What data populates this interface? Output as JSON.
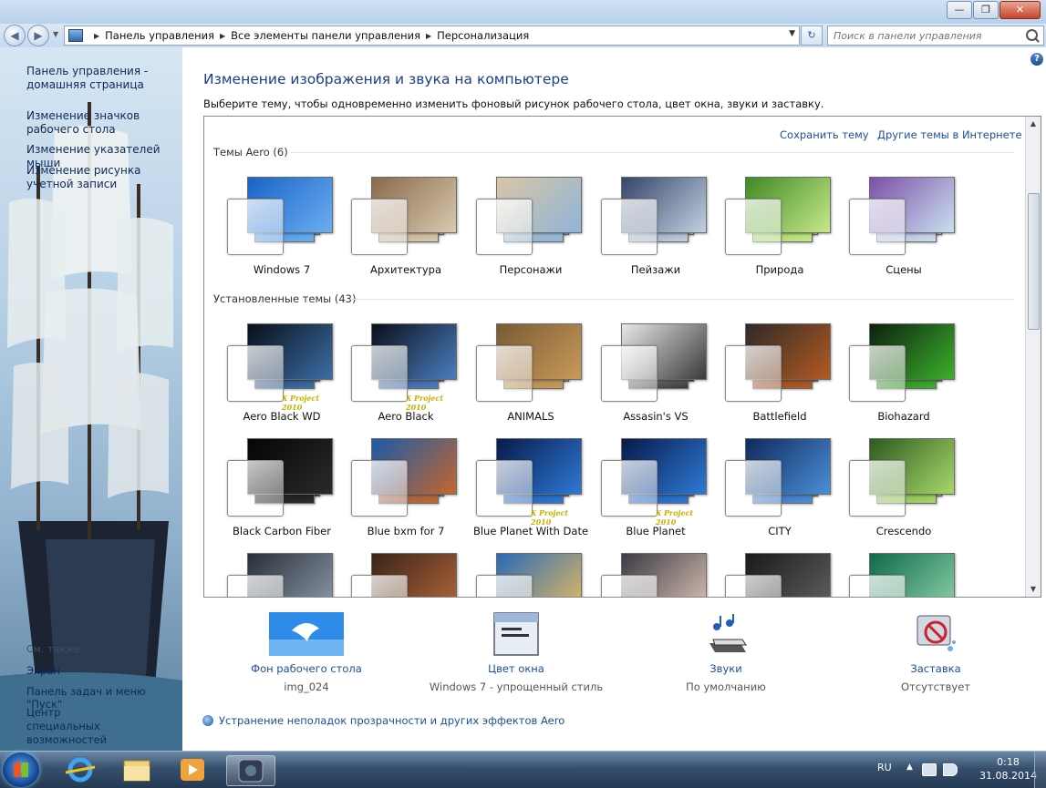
{
  "window": {
    "minimize": "—",
    "maximize": "❐",
    "close": "✕"
  },
  "address": {
    "crumbs": [
      "Панель управления",
      "Все элементы панели управления",
      "Персонализация"
    ],
    "search_placeholder": "Поиск в панели управления"
  },
  "sidebar": {
    "links": [
      {
        "label": "Панель управления - домашняя страница"
      },
      {
        "label": "Изменение значков рабочего стола"
      },
      {
        "label": "Изменение указателей мыши"
      },
      {
        "label": "Изменение рисунка учетной записи"
      }
    ],
    "see_also_title": "См. также",
    "see_also": [
      "Экран",
      "Панель задач и меню \"Пуск\"",
      "Центр специальных возможностей"
    ]
  },
  "main": {
    "title": "Изменение изображения и звука на компьютере",
    "subtitle": "Выберите тему, чтобы одновременно изменить фоновый рисунок рабочего стола, цвет окна, звуки и заставку.",
    "save_theme": "Сохранить тему",
    "other_themes": "Другие темы в Интернете",
    "aero_label": "Темы Aero (6)",
    "installed_label": "Установленные темы (43)",
    "watermark": "X Project 2010",
    "aero_themes": [
      {
        "name": "Windows 7",
        "colors": [
          "#1a63c7",
          "#6aaef0"
        ]
      },
      {
        "name": "Архитектура",
        "colors": [
          "#8a6a4a",
          "#d8c9b0"
        ]
      },
      {
        "name": "Персонажи",
        "colors": [
          "#d9c6a5",
          "#8fb5d8"
        ]
      },
      {
        "name": "Пейзажи",
        "colors": [
          "#35456a",
          "#c2d0e0"
        ]
      },
      {
        "name": "Природа",
        "colors": [
          "#3f8a24",
          "#c7e88a"
        ]
      },
      {
        "name": "Сцены",
        "colors": [
          "#7c4fa8",
          "#c9e0f0"
        ]
      }
    ],
    "installed_themes": [
      {
        "name": "Aero Black WD",
        "colors": [
          "#0a0f1a",
          "#3b6ea5"
        ]
      },
      {
        "name": "Aero Black",
        "colors": [
          "#0a0f1a",
          "#4a7dbf"
        ]
      },
      {
        "name": "ANIMALS",
        "colors": [
          "#7a5a33",
          "#c89a5a"
        ]
      },
      {
        "name": "Assasin's VS",
        "colors": [
          "#e8e8e8",
          "#3a3a3a"
        ]
      },
      {
        "name": "Battlefield",
        "colors": [
          "#2e2a28",
          "#b35a22"
        ]
      },
      {
        "name": "Biohazard",
        "colors": [
          "#0d2010",
          "#3bb02a"
        ]
      },
      {
        "name": "Black Carbon Fiber",
        "colors": [
          "#050505",
          "#2a2a2a"
        ]
      },
      {
        "name": "Blue bxm  for 7",
        "colors": [
          "#1b5aa8",
          "#c2672e"
        ]
      },
      {
        "name": "Blue Planet With Date",
        "colors": [
          "#081a4a",
          "#2e79d6"
        ]
      },
      {
        "name": "Blue Planet",
        "colors": [
          "#081a4a",
          "#2e79d6"
        ]
      },
      {
        "name": "CITY",
        "colors": [
          "#0f2a5c",
          "#4b8ed8"
        ]
      },
      {
        "name": "Crescendo",
        "colors": [
          "#2d5a1e",
          "#a8d86a"
        ]
      },
      {
        "name": "",
        "colors": [
          "#2a2f38",
          "#8a98a8"
        ]
      },
      {
        "name": "",
        "colors": [
          "#3a2418",
          "#b0643a"
        ]
      },
      {
        "name": "",
        "colors": [
          "#2a6ab8",
          "#e0b860"
        ]
      },
      {
        "name": "",
        "colors": [
          "#3a3a44",
          "#d8c0b0"
        ]
      },
      {
        "name": "",
        "colors": [
          "#1a1a1a",
          "#606060"
        ]
      },
      {
        "name": "",
        "colors": [
          "#0f6a4a",
          "#8ad0a8"
        ]
      }
    ]
  },
  "settings": [
    {
      "label": "Фон рабочего стола",
      "value": "img_024"
    },
    {
      "label": "Цвет окна",
      "value": "Windows 7 - упрощенный стиль"
    },
    {
      "label": "Звуки",
      "value": "По умолчанию"
    },
    {
      "label": "Заставка",
      "value": "Отсутствует"
    }
  ],
  "troubleshoot": "Устранение неполадок прозрачности и других эффектов Aero",
  "taskbar": {
    "lang": "RU",
    "time": "0:18",
    "date": "31.08.2014"
  }
}
